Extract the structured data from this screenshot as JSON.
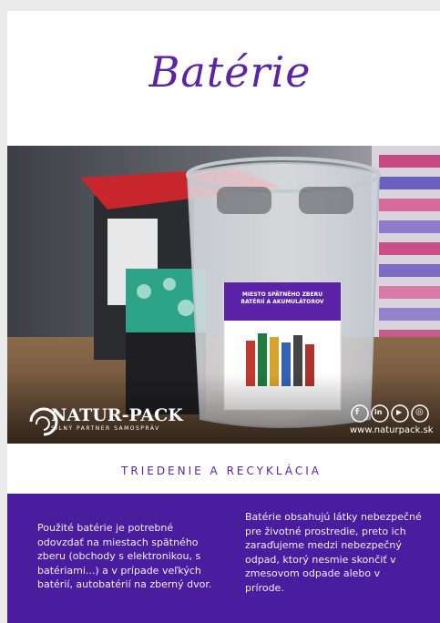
{
  "title": "Batérie",
  "photo": {
    "bin_label_line1": "MIESTO SPÄTNÉHO ZBERU",
    "bin_label_line2": "BATÉRIÍ A AKUMULÁTOROV",
    "logo_name": "NATUR-PACK",
    "logo_tagline": "SILNÝ PARTNER SAMOSPRÁV",
    "website": "www.naturpack.sk",
    "social_icons": [
      "facebook-icon",
      "linkedin-icon",
      "youtube-icon",
      "instagram-icon"
    ]
  },
  "subtitle": "TRIEDENIE A RECYKLÁCIA",
  "text_left": "Použité batérie je potrebné odovzdať na miestach spätného zberu (obchody s elektronikou, s batériami...) a v prípade veľkých batérií, autobatérií na zberný dvor.",
  "text_right": "Batérie obsahujú látky nebezpečné pre životné prostredie, preto ich zaraďujeme medzi nebezpečný odpad, ktorý nesmie skončiť v zmesovom odpade alebo v prírode.",
  "colors": {
    "accent": "#5b24a7",
    "panel": "#4a1c9e"
  }
}
